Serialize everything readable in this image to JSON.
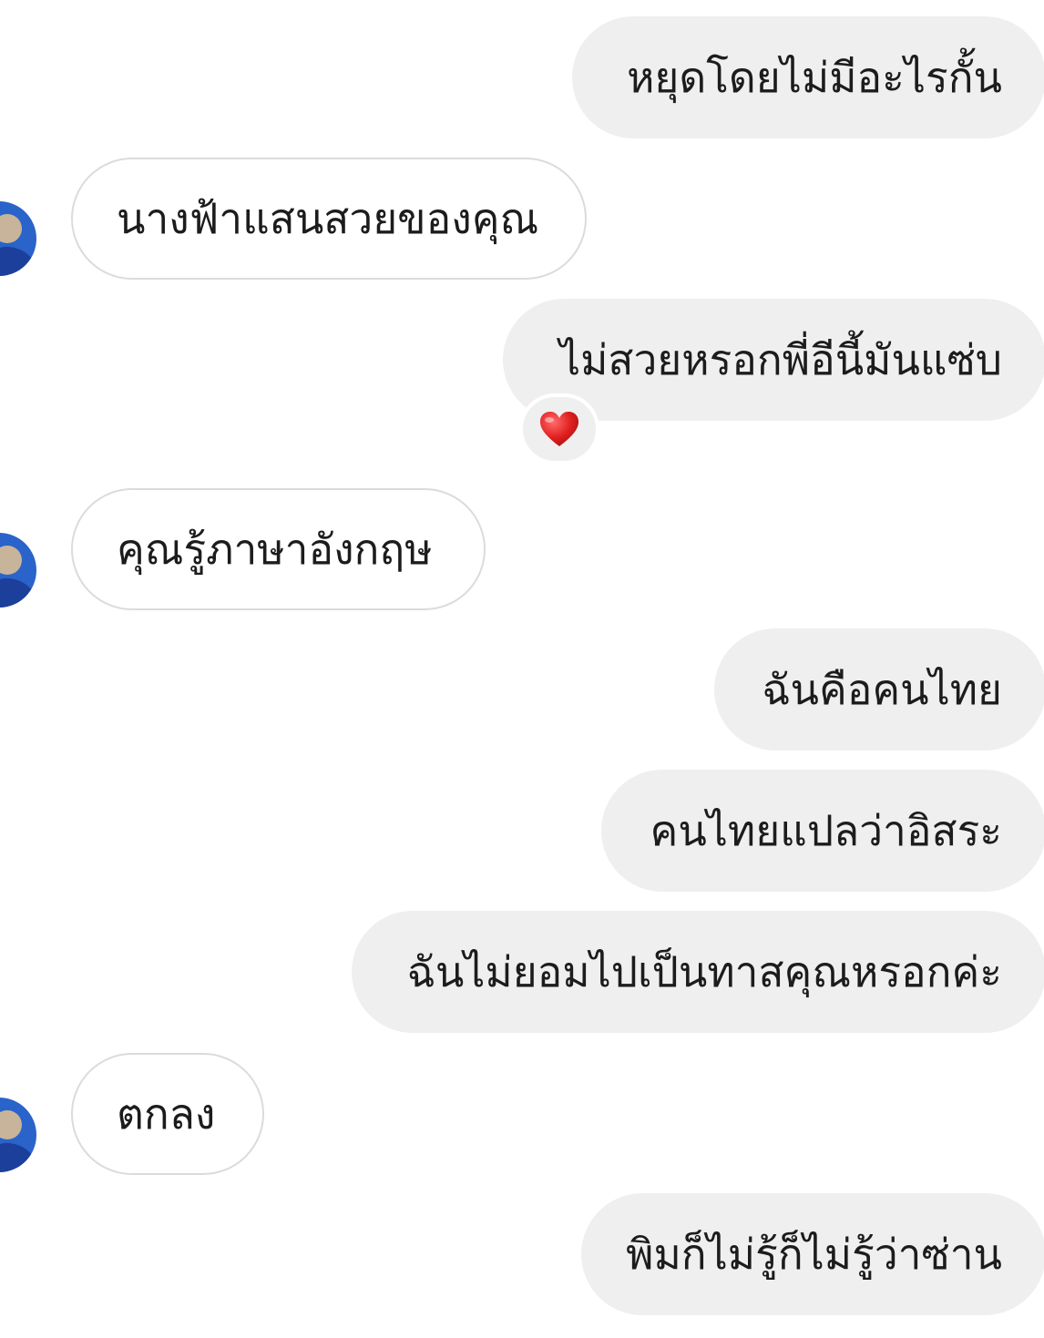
{
  "messages": [
    {
      "direction": "outgoing",
      "text": "หยุดโดยไม่มีอะไรกั้น"
    },
    {
      "direction": "incoming",
      "text": "นางฟ้าแสนสวยของคุณ"
    },
    {
      "direction": "outgoing",
      "text": "ไม่สวยหรอกพี่อีนี้มันแซ่บ",
      "reaction": "heart"
    },
    {
      "direction": "incoming",
      "text": "คุณรู้ภาษาอังกฤษ"
    },
    {
      "direction": "outgoing",
      "text": "ฉันคือคนไทย"
    },
    {
      "direction": "outgoing",
      "text": "คนไทยแปลว่าอิสระ"
    },
    {
      "direction": "outgoing",
      "text": "ฉันไม่ยอมไปเป็นทาสคุณหรอกค่ะ"
    },
    {
      "direction": "incoming",
      "text": "ตกลง"
    },
    {
      "direction": "outgoing",
      "text": "พิมก็ไม่รู้ก็ไม่รู้ว่าซ่าน"
    }
  ],
  "colors": {
    "outgoing_bubble": "#efefef",
    "incoming_bubble": "#ffffff",
    "incoming_border": "#dbdbdb",
    "text": "#1c1c1c",
    "heart": "#e0201f",
    "avatar": "#1f4fb5"
  },
  "icons": {
    "reaction": "heart-icon",
    "avatar": "user-avatar"
  }
}
